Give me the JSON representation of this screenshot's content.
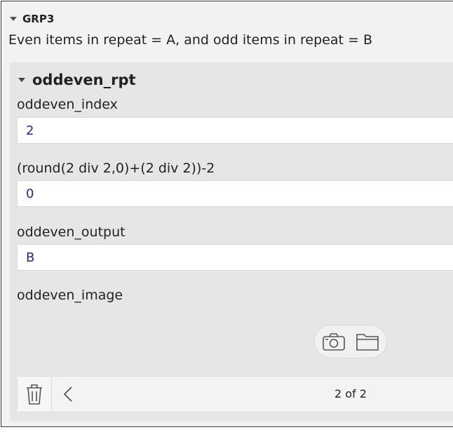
{
  "group": {
    "title": "GRP3",
    "label": "Even items in repeat = A, and odd items in repeat = B"
  },
  "repeat": {
    "title": "oddeven_rpt",
    "questions": [
      {
        "label": "oddeven_index",
        "value": "2"
      },
      {
        "label": "(round(2 div 2,0)+(2 div 2))-2",
        "value": "0"
      },
      {
        "label": "oddeven_output",
        "value": "B"
      },
      {
        "label": "oddeven_image"
      }
    ],
    "footer": {
      "page_count": "2 of 2"
    }
  },
  "icons": {
    "group_toggle": "caret-down-icon",
    "repeat_toggle": "caret-down-icon",
    "camera": "camera-icon",
    "folder": "folder-icon",
    "trash": "trash-icon",
    "prev": "chevron-left-icon"
  },
  "colors": {
    "value_text": "#1f2a8a",
    "group_bg": "#f2f2f2",
    "repeat_bg": "#e6e6e6"
  }
}
